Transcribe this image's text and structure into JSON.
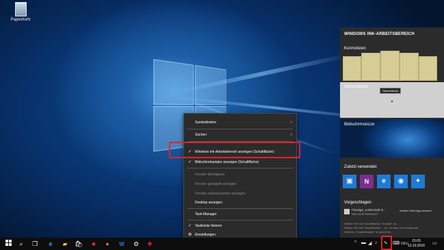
{
  "desktop": {
    "recycle_bin_label": "Papierkorb"
  },
  "context_menu": {
    "items": [
      {
        "label": "Symbolleisten",
        "has_submenu": true
      },
      {
        "label": "Suchen",
        "has_submenu": true
      },
      {
        "label": "Windows Ink-Arbeitsbereich anzeigen (Schaltfläche)",
        "checked": true
      },
      {
        "label": "Bildschirmtastatur anzeigen (Schaltfläche)",
        "checked": true
      },
      {
        "label": "Fenster überlappen",
        "disabled": true
      },
      {
        "label": "Fenster gestapelt anzeigen",
        "disabled": true
      },
      {
        "label": "Fenster nebeneinander anzeigen",
        "disabled": true
      },
      {
        "label": "Desktop anzeigen"
      },
      {
        "label": "Task-Manager"
      },
      {
        "label": "Taskleiste fixieren",
        "checked": true
      },
      {
        "label": "Einstellungen",
        "icon": "gear-icon"
      }
    ],
    "highlight_color": "#e0222a"
  },
  "ink_panel": {
    "title": "WINDOWS INK-ARBEITSBEREICH",
    "sticky_notes_label": "Kurznotizen",
    "sketchpad_label": "Skizzenblock",
    "sketchpad_tooltip": "Skizzenblock",
    "screen_sketch_label": "Bildschirmskizze",
    "recent_label": "Zuletzt verwendet",
    "recent_apps": [
      {
        "icon": "photos-icon",
        "color": "#1e7ad6"
      },
      {
        "icon": "onenote-icon",
        "color": "#7b2e8e"
      },
      {
        "icon": "edge-icon",
        "color": "#1e7ad6"
      },
      {
        "icon": "maps-icon",
        "color": "#1e7ad6"
      },
      {
        "icon": "tips-icon",
        "color": "#1e7ad6"
      }
    ],
    "suggested_label": "Vorgeschlagen",
    "suggested_app": "Fluesign, a Microsoft G...",
    "suggested_publisher": "Microsoft Research",
    "suggested_more": "Weitere Stift-Apps abrufen",
    "suggested_note_1": "Wählen Sie Ihre Schaltflächen \"Zulässt\" an,",
    "suggested_note_2": "Passen Sie Ihre Schaltflächen ... an. Ich kann es in Angebote",
    "suggested_note_3": "erfahren, \"Ausstellungen\" zu genießen."
  },
  "taskbar": {
    "clock_time": "15:03",
    "clock_date": "13.10.2016",
    "lang": "DEU",
    "pen_highlight_color": "#e0222a"
  }
}
